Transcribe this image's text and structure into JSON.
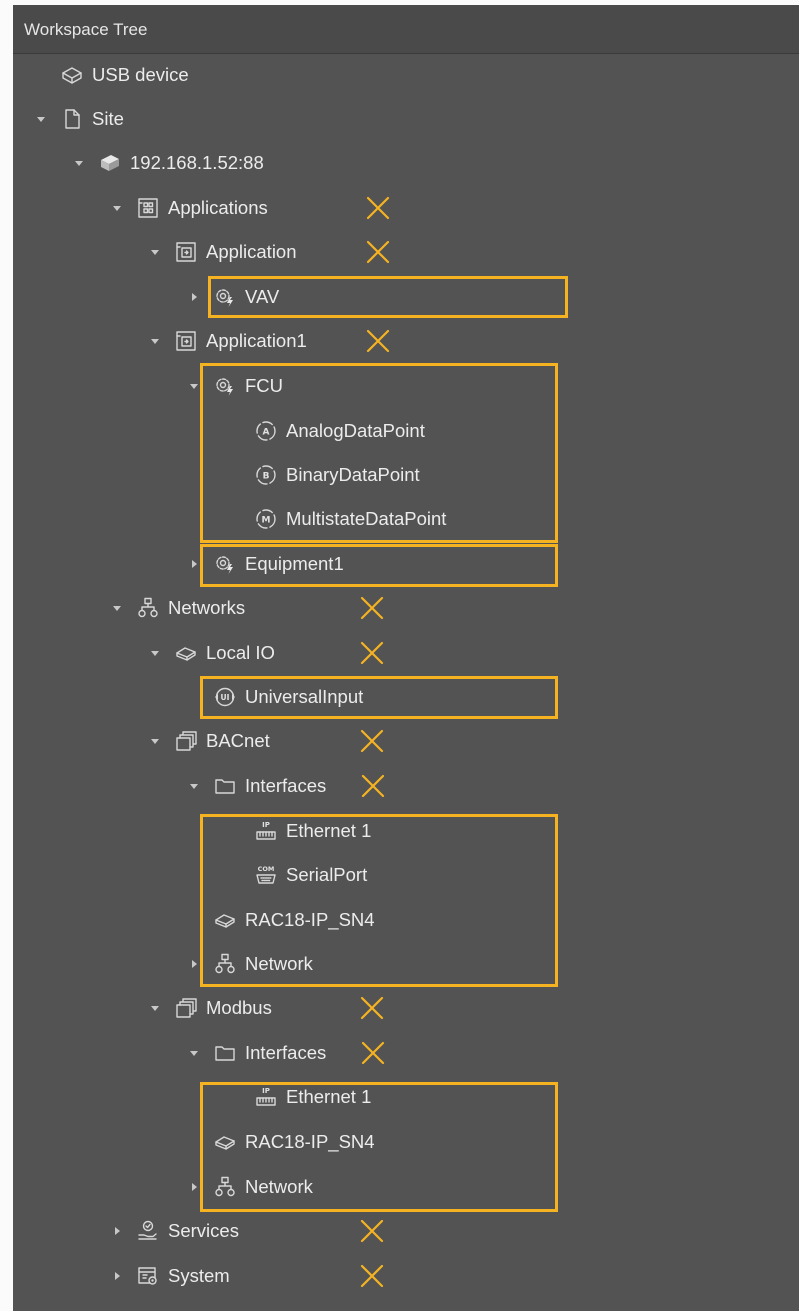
{
  "panel": {
    "title": "Workspace Tree"
  },
  "colors": {
    "highlight": "#f5b321",
    "mark": "#f5b321",
    "text": "#ececec",
    "background": "#535353"
  },
  "tree": [
    {
      "key": "usb",
      "label": "USB device",
      "icon": "usb-device-icon",
      "expanded": null,
      "marked": false
    },
    {
      "key": "site",
      "label": "Site",
      "icon": "document-icon",
      "expanded": true,
      "marked": false
    },
    {
      "key": "server",
      "label": "192.168.1.52:88",
      "icon": "server-icon",
      "expanded": true,
      "marked": false
    },
    {
      "key": "applications",
      "label": "Applications",
      "icon": "applications-icon",
      "expanded": true,
      "marked": true
    },
    {
      "key": "application",
      "label": "Application",
      "icon": "application-icon",
      "expanded": true,
      "marked": true
    },
    {
      "key": "vav",
      "label": "VAV",
      "icon": "equipment-gear-icon",
      "expanded": false,
      "marked": false
    },
    {
      "key": "application1",
      "label": "Application1",
      "icon": "application-icon",
      "expanded": true,
      "marked": true
    },
    {
      "key": "fcu",
      "label": "FCU",
      "icon": "equipment-gear-icon",
      "expanded": true,
      "marked": false
    },
    {
      "key": "analog",
      "label": "AnalogDataPoint",
      "icon": "analog-datapoint-icon",
      "expanded": null,
      "marked": false
    },
    {
      "key": "binary",
      "label": "BinaryDataPoint",
      "icon": "binary-datapoint-icon",
      "expanded": null,
      "marked": false
    },
    {
      "key": "multistate",
      "label": "MultistateDataPoint",
      "icon": "multistate-datapoint-icon",
      "expanded": null,
      "marked": false
    },
    {
      "key": "equipment1",
      "label": "Equipment1",
      "icon": "equipment-gear-icon",
      "expanded": false,
      "marked": false
    },
    {
      "key": "networks",
      "label": "Networks",
      "icon": "network-icon",
      "expanded": true,
      "marked": true
    },
    {
      "key": "localio",
      "label": "Local IO",
      "icon": "device-icon",
      "expanded": true,
      "marked": true
    },
    {
      "key": "universalinput",
      "label": "UniversalInput",
      "icon": "universal-input-icon",
      "expanded": null,
      "marked": false
    },
    {
      "key": "bacnet",
      "label": "BACnet",
      "icon": "protocol-icon",
      "expanded": true,
      "marked": true
    },
    {
      "key": "bacnet_interfaces",
      "label": "Interfaces",
      "icon": "folder-icon",
      "expanded": true,
      "marked": true
    },
    {
      "key": "bacnet_eth",
      "label": "Ethernet 1",
      "icon": "ethernet-icon",
      "expanded": null,
      "marked": false
    },
    {
      "key": "bacnet_serial",
      "label": "SerialPort",
      "icon": "serial-port-icon",
      "expanded": null,
      "marked": false
    },
    {
      "key": "bacnet_rac",
      "label": "RAC18-IP_SN4",
      "icon": "device-icon",
      "expanded": null,
      "marked": false
    },
    {
      "key": "bacnet_network",
      "label": "Network",
      "icon": "network-icon",
      "expanded": false,
      "marked": false
    },
    {
      "key": "modbus",
      "label": "Modbus",
      "icon": "protocol-icon",
      "expanded": true,
      "marked": true
    },
    {
      "key": "modbus_interfaces",
      "label": "Interfaces",
      "icon": "folder-icon",
      "expanded": true,
      "marked": true
    },
    {
      "key": "modbus_eth",
      "label": "Ethernet 1",
      "icon": "ethernet-icon",
      "expanded": null,
      "marked": false
    },
    {
      "key": "modbus_rac",
      "label": "RAC18-IP_SN4",
      "icon": "device-icon",
      "expanded": null,
      "marked": false
    },
    {
      "key": "modbus_network",
      "label": "Network",
      "icon": "network-icon",
      "expanded": false,
      "marked": false
    },
    {
      "key": "services",
      "label": "Services",
      "icon": "services-icon",
      "expanded": false,
      "marked": true
    },
    {
      "key": "system",
      "label": "System",
      "icon": "system-icon",
      "expanded": false,
      "marked": true
    }
  ],
  "icon_text": {
    "ethernet": "IP",
    "serial": "COM",
    "analog": "A",
    "binary": "B",
    "multistate": "M",
    "universal": "UI"
  }
}
